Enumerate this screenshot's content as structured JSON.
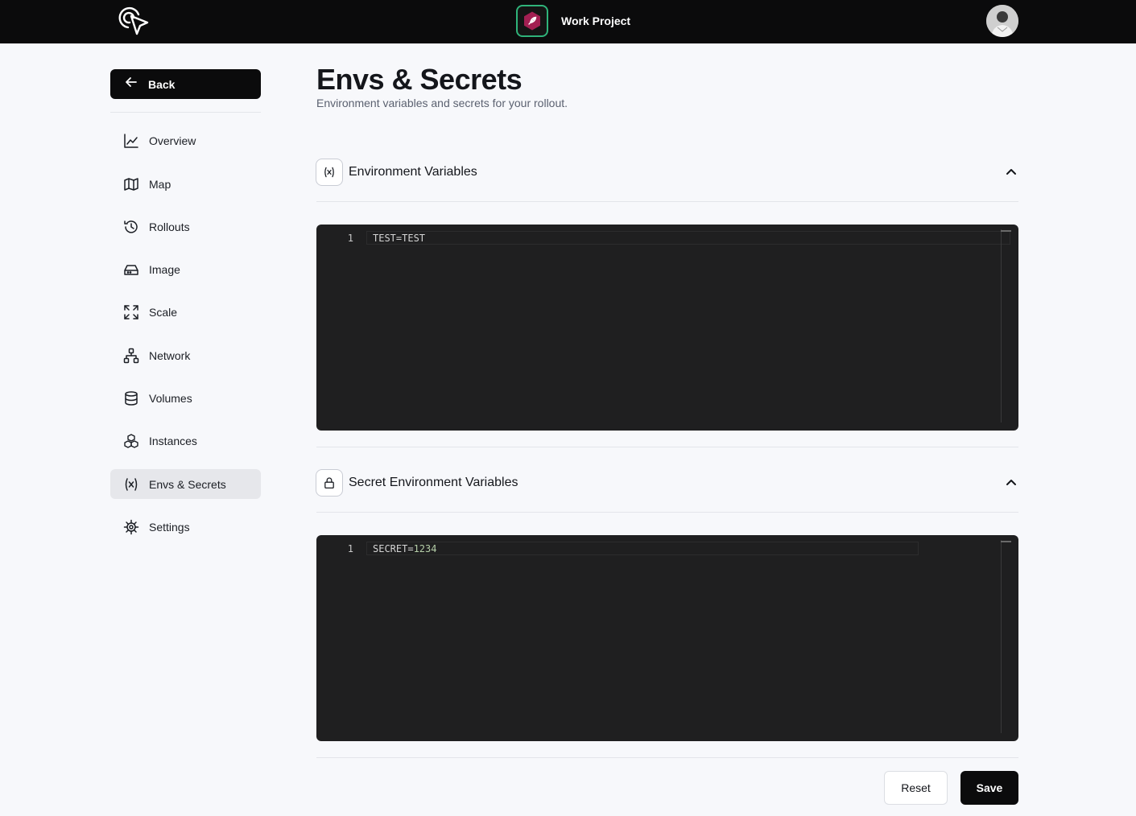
{
  "header": {
    "project_name": "Work Project",
    "logo_icon": "cursor-click-icon",
    "project_icon": "hexagon-feather-icon",
    "project_border_color": "#2fb37a",
    "project_icon_color": "#a31f52"
  },
  "sidebar": {
    "back_label": "Back",
    "items": [
      {
        "label": "Overview",
        "icon": "line-chart-icon"
      },
      {
        "label": "Map",
        "icon": "map-icon"
      },
      {
        "label": "Rollouts",
        "icon": "history-icon"
      },
      {
        "label": "Image",
        "icon": "hard-drive-icon"
      },
      {
        "label": "Scale",
        "icon": "expand-icon"
      },
      {
        "label": "Network",
        "icon": "network-icon"
      },
      {
        "label": "Volumes",
        "icon": "database-icon"
      },
      {
        "label": "Instances",
        "icon": "boxes-icon"
      },
      {
        "label": "Envs & Secrets",
        "icon": "variable-icon",
        "active": true
      },
      {
        "label": "Settings",
        "icon": "cog-icon"
      }
    ]
  },
  "main": {
    "title": "Envs & Secrets",
    "subtitle": "Environment variables and secrets for your rollout.",
    "sections": [
      {
        "title": "Environment Variables",
        "icon": "variable-icon",
        "lines": [
          {
            "number": "1",
            "key": "TEST=",
            "value": "TEST"
          }
        ]
      },
      {
        "title": "Secret Environment Variables",
        "icon": "lock-icon",
        "lines": [
          {
            "number": "1",
            "key": "SECRET=",
            "value": "1234"
          }
        ]
      }
    ]
  },
  "actions": {
    "reset_label": "Reset",
    "save_label": "Save"
  }
}
